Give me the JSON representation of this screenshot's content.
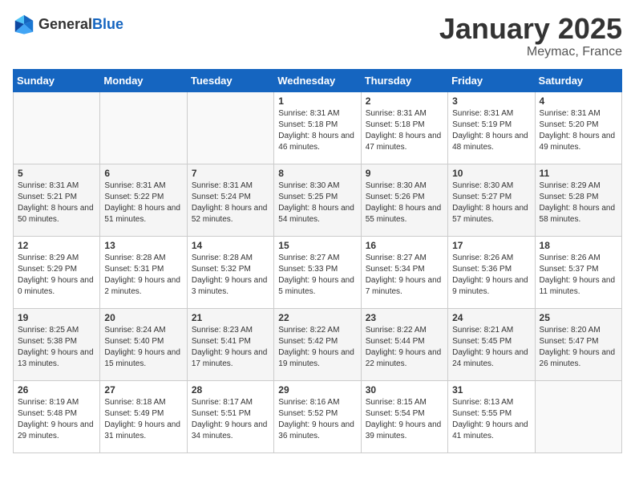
{
  "header": {
    "logo_general": "General",
    "logo_blue": "Blue",
    "title": "January 2025",
    "subtitle": "Meymac, France"
  },
  "weekdays": [
    "Sunday",
    "Monday",
    "Tuesday",
    "Wednesday",
    "Thursday",
    "Friday",
    "Saturday"
  ],
  "weeks": [
    [
      {
        "num": "",
        "sunrise": "",
        "sunset": "",
        "daylight": ""
      },
      {
        "num": "",
        "sunrise": "",
        "sunset": "",
        "daylight": ""
      },
      {
        "num": "",
        "sunrise": "",
        "sunset": "",
        "daylight": ""
      },
      {
        "num": "1",
        "sunrise": "Sunrise: 8:31 AM",
        "sunset": "Sunset: 5:18 PM",
        "daylight": "Daylight: 8 hours and 46 minutes."
      },
      {
        "num": "2",
        "sunrise": "Sunrise: 8:31 AM",
        "sunset": "Sunset: 5:18 PM",
        "daylight": "Daylight: 8 hours and 47 minutes."
      },
      {
        "num": "3",
        "sunrise": "Sunrise: 8:31 AM",
        "sunset": "Sunset: 5:19 PM",
        "daylight": "Daylight: 8 hours and 48 minutes."
      },
      {
        "num": "4",
        "sunrise": "Sunrise: 8:31 AM",
        "sunset": "Sunset: 5:20 PM",
        "daylight": "Daylight: 8 hours and 49 minutes."
      }
    ],
    [
      {
        "num": "5",
        "sunrise": "Sunrise: 8:31 AM",
        "sunset": "Sunset: 5:21 PM",
        "daylight": "Daylight: 8 hours and 50 minutes."
      },
      {
        "num": "6",
        "sunrise": "Sunrise: 8:31 AM",
        "sunset": "Sunset: 5:22 PM",
        "daylight": "Daylight: 8 hours and 51 minutes."
      },
      {
        "num": "7",
        "sunrise": "Sunrise: 8:31 AM",
        "sunset": "Sunset: 5:24 PM",
        "daylight": "Daylight: 8 hours and 52 minutes."
      },
      {
        "num": "8",
        "sunrise": "Sunrise: 8:30 AM",
        "sunset": "Sunset: 5:25 PM",
        "daylight": "Daylight: 8 hours and 54 minutes."
      },
      {
        "num": "9",
        "sunrise": "Sunrise: 8:30 AM",
        "sunset": "Sunset: 5:26 PM",
        "daylight": "Daylight: 8 hours and 55 minutes."
      },
      {
        "num": "10",
        "sunrise": "Sunrise: 8:30 AM",
        "sunset": "Sunset: 5:27 PM",
        "daylight": "Daylight: 8 hours and 57 minutes."
      },
      {
        "num": "11",
        "sunrise": "Sunrise: 8:29 AM",
        "sunset": "Sunset: 5:28 PM",
        "daylight": "Daylight: 8 hours and 58 minutes."
      }
    ],
    [
      {
        "num": "12",
        "sunrise": "Sunrise: 8:29 AM",
        "sunset": "Sunset: 5:29 PM",
        "daylight": "Daylight: 9 hours and 0 minutes."
      },
      {
        "num": "13",
        "sunrise": "Sunrise: 8:28 AM",
        "sunset": "Sunset: 5:31 PM",
        "daylight": "Daylight: 9 hours and 2 minutes."
      },
      {
        "num": "14",
        "sunrise": "Sunrise: 8:28 AM",
        "sunset": "Sunset: 5:32 PM",
        "daylight": "Daylight: 9 hours and 3 minutes."
      },
      {
        "num": "15",
        "sunrise": "Sunrise: 8:27 AM",
        "sunset": "Sunset: 5:33 PM",
        "daylight": "Daylight: 9 hours and 5 minutes."
      },
      {
        "num": "16",
        "sunrise": "Sunrise: 8:27 AM",
        "sunset": "Sunset: 5:34 PM",
        "daylight": "Daylight: 9 hours and 7 minutes."
      },
      {
        "num": "17",
        "sunrise": "Sunrise: 8:26 AM",
        "sunset": "Sunset: 5:36 PM",
        "daylight": "Daylight: 9 hours and 9 minutes."
      },
      {
        "num": "18",
        "sunrise": "Sunrise: 8:26 AM",
        "sunset": "Sunset: 5:37 PM",
        "daylight": "Daylight: 9 hours and 11 minutes."
      }
    ],
    [
      {
        "num": "19",
        "sunrise": "Sunrise: 8:25 AM",
        "sunset": "Sunset: 5:38 PM",
        "daylight": "Daylight: 9 hours and 13 minutes."
      },
      {
        "num": "20",
        "sunrise": "Sunrise: 8:24 AM",
        "sunset": "Sunset: 5:40 PM",
        "daylight": "Daylight: 9 hours and 15 minutes."
      },
      {
        "num": "21",
        "sunrise": "Sunrise: 8:23 AM",
        "sunset": "Sunset: 5:41 PM",
        "daylight": "Daylight: 9 hours and 17 minutes."
      },
      {
        "num": "22",
        "sunrise": "Sunrise: 8:22 AM",
        "sunset": "Sunset: 5:42 PM",
        "daylight": "Daylight: 9 hours and 19 minutes."
      },
      {
        "num": "23",
        "sunrise": "Sunrise: 8:22 AM",
        "sunset": "Sunset: 5:44 PM",
        "daylight": "Daylight: 9 hours and 22 minutes."
      },
      {
        "num": "24",
        "sunrise": "Sunrise: 8:21 AM",
        "sunset": "Sunset: 5:45 PM",
        "daylight": "Daylight: 9 hours and 24 minutes."
      },
      {
        "num": "25",
        "sunrise": "Sunrise: 8:20 AM",
        "sunset": "Sunset: 5:47 PM",
        "daylight": "Daylight: 9 hours and 26 minutes."
      }
    ],
    [
      {
        "num": "26",
        "sunrise": "Sunrise: 8:19 AM",
        "sunset": "Sunset: 5:48 PM",
        "daylight": "Daylight: 9 hours and 29 minutes."
      },
      {
        "num": "27",
        "sunrise": "Sunrise: 8:18 AM",
        "sunset": "Sunset: 5:49 PM",
        "daylight": "Daylight: 9 hours and 31 minutes."
      },
      {
        "num": "28",
        "sunrise": "Sunrise: 8:17 AM",
        "sunset": "Sunset: 5:51 PM",
        "daylight": "Daylight: 9 hours and 34 minutes."
      },
      {
        "num": "29",
        "sunrise": "Sunrise: 8:16 AM",
        "sunset": "Sunset: 5:52 PM",
        "daylight": "Daylight: 9 hours and 36 minutes."
      },
      {
        "num": "30",
        "sunrise": "Sunrise: 8:15 AM",
        "sunset": "Sunset: 5:54 PM",
        "daylight": "Daylight: 9 hours and 39 minutes."
      },
      {
        "num": "31",
        "sunrise": "Sunrise: 8:13 AM",
        "sunset": "Sunset: 5:55 PM",
        "daylight": "Daylight: 9 hours and 41 minutes."
      },
      {
        "num": "",
        "sunrise": "",
        "sunset": "",
        "daylight": ""
      }
    ]
  ]
}
